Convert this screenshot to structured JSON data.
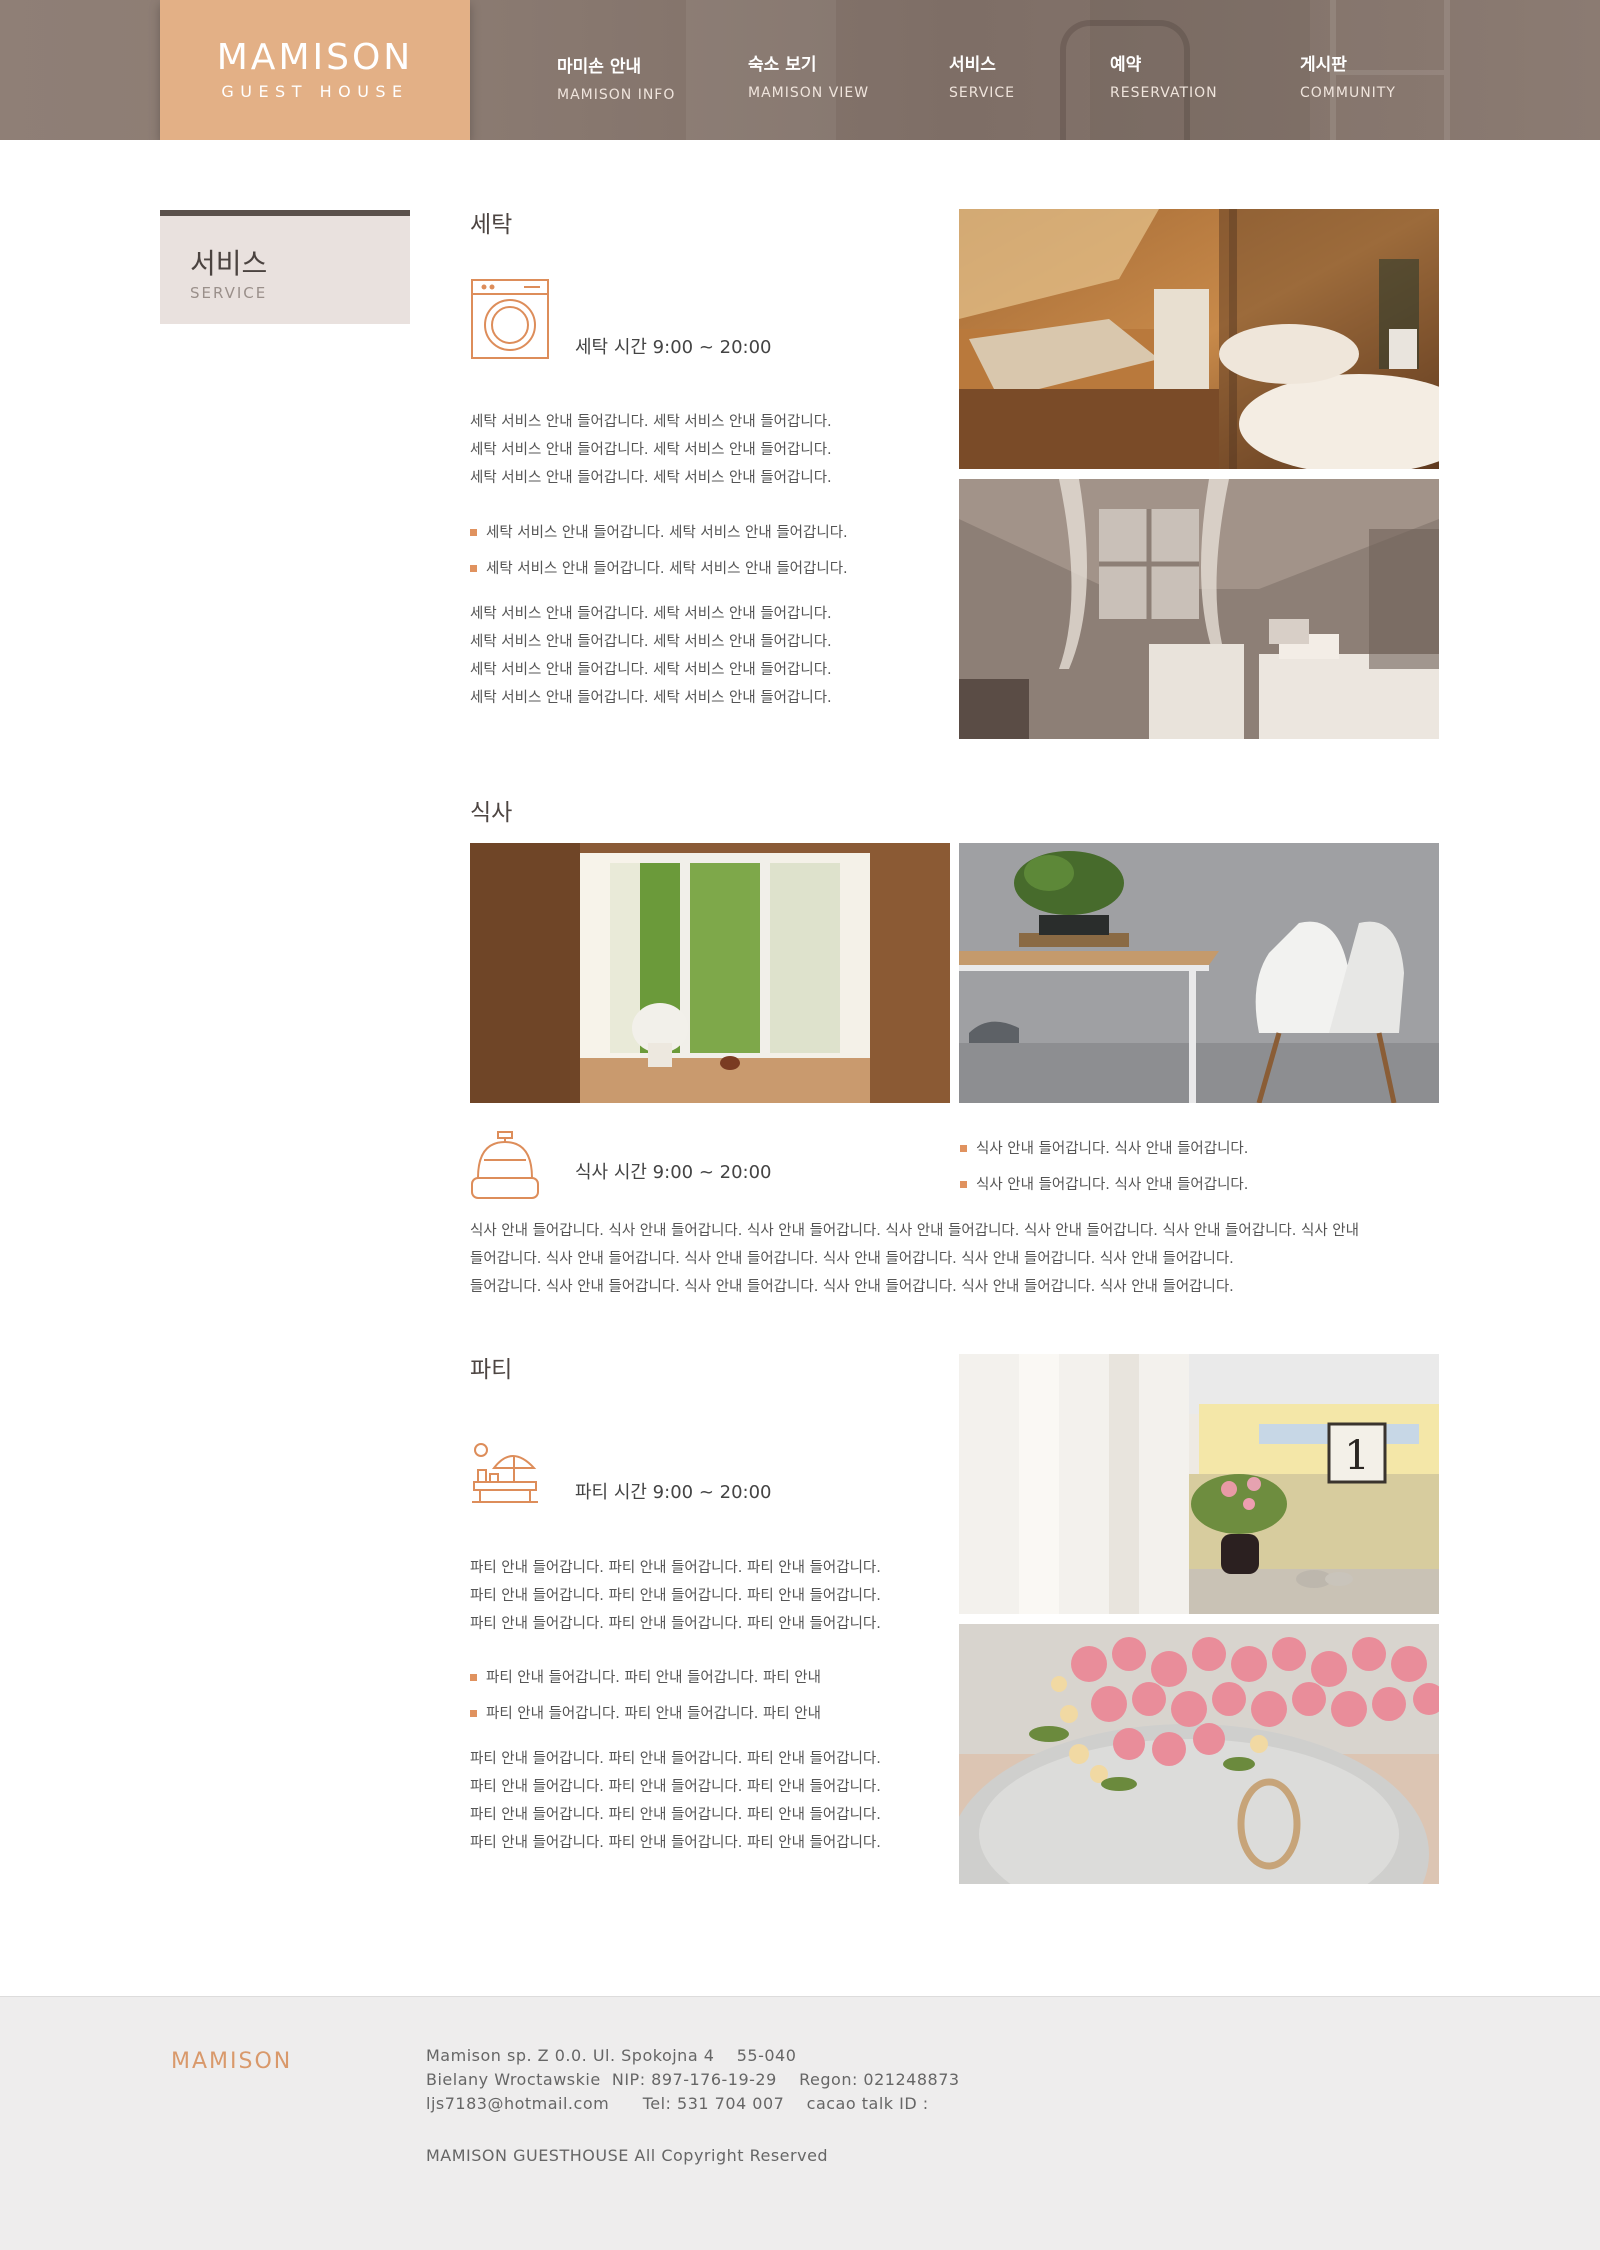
{
  "brand": {
    "logo_main": "MAMISON",
    "logo_sub": "GUEST HOUSE",
    "accent_color": "#e3b086",
    "bullet_color": "#e0925f",
    "icon_color": "#dd8d5a"
  },
  "nav": [
    {
      "ko": "마미손 안내",
      "en": "MAMISON INFO"
    },
    {
      "ko": "숙소 보기",
      "en": "MAMISON VIEW"
    },
    {
      "ko": "서비스",
      "en": "SERVICE"
    },
    {
      "ko": "예약",
      "en": "RESERVATION"
    },
    {
      "ko": "게시판",
      "en": "COMMUNITY"
    }
  ],
  "sidebar": {
    "title": "서비스",
    "subtitle": "SERVICE"
  },
  "laundry": {
    "title": "세탁",
    "icon": "washing-machine-icon",
    "hours": "세탁 시간 9:00 ~ 20:00",
    "para1": [
      "세탁 서비스 안내 들어갑니다. 세탁 서비스 안내 들어갑니다.",
      "세탁 서비스 안내 들어갑니다. 세탁 서비스 안내 들어갑니다.",
      "세탁 서비스 안내 들어갑니다. 세탁 서비스 안내 들어갑니다."
    ],
    "bullets": [
      "세탁 서비스 안내 들어갑니다. 세탁 서비스 안내 들어갑니다.",
      "세탁 서비스 안내 들어갑니다. 세탁 서비스 안내 들어갑니다."
    ],
    "para2": [
      "세탁 서비스 안내 들어갑니다. 세탁 서비스 안내 들어갑니다.",
      "세탁 서비스 안내 들어갑니다. 세탁 서비스 안내 들어갑니다.",
      "세탁 서비스 안내 들어갑니다. 세탁 서비스 안내 들어갑니다.",
      "세탁 서비스 안내 들어갑니다. 세탁 서비스 안내 들어갑니다."
    ]
  },
  "meal": {
    "title": "식사",
    "icon": "service-bell-icon",
    "hours": "식사 시간 9:00 ~ 20:00",
    "bullets": [
      "식사 안내 들어갑니다. 식사 안내 들어갑니다.",
      "식사 안내 들어갑니다. 식사 안내 들어갑니다."
    ],
    "para": [
      "식사 안내 들어갑니다. 식사 안내 들어갑니다. 식사 안내 들어갑니다. 식사 안내 들어갑니다. 식사 안내 들어갑니다. 식사 안내 들어갑니다. 식사 안내",
      "들어갑니다. 식사 안내 들어갑니다. 식사 안내 들어갑니다. 식사 안내 들어갑니다. 식사 안내 들어갑니다. 식사 안내 들어갑니다.",
      "들어갑니다. 식사 안내 들어갑니다. 식사 안내 들어갑니다. 식사 안내 들어갑니다. 식사 안내 들어갑니다. 식사 안내 들어갑니다."
    ]
  },
  "party": {
    "title": "파티",
    "icon": "party-table-icon",
    "hours": "파티 시간 9:00 ~ 20:00",
    "para1": [
      "파티 안내 들어갑니다. 파티 안내 들어갑니다. 파티 안내 들어갑니다.",
      "파티 안내 들어갑니다. 파티 안내 들어갑니다. 파티 안내 들어갑니다.",
      "파티 안내 들어갑니다. 파티 안내 들어갑니다. 파티 안내 들어갑니다."
    ],
    "bullets": [
      "파티 안내 들어갑니다. 파티 안내 들어갑니다. 파티 안내",
      "파티 안내 들어갑니다. 파티 안내 들어갑니다. 파티 안내"
    ],
    "para2": [
      "파티 안내 들어갑니다. 파티 안내 들어갑니다. 파티 안내 들어갑니다.",
      "파티 안내 들어갑니다. 파티 안내 들어갑니다. 파티 안내 들어갑니다.",
      "파티 안내 들어갑니다. 파티 안내 들어갑니다. 파티 안내 들어갑니다.",
      "파티 안내 들어갑니다. 파티 안내 들어갑니다. 파티 안내 들어갑니다."
    ],
    "photo_number": "1"
  },
  "footer": {
    "logo": "MAMISON",
    "line1": "Mamison sp. Z 0.0. Ul. Spokojna 4    55-040",
    "line2": "Bielany Wroctawskie  NIP: 897-176-19-29    Regon: 021248873",
    "line3": "ljs7183@hotmail.com      Tel: 531 704 007    cacao talk ID :",
    "copyright": "MAMISON GUESTHOUSE All Copyright Reserved"
  }
}
